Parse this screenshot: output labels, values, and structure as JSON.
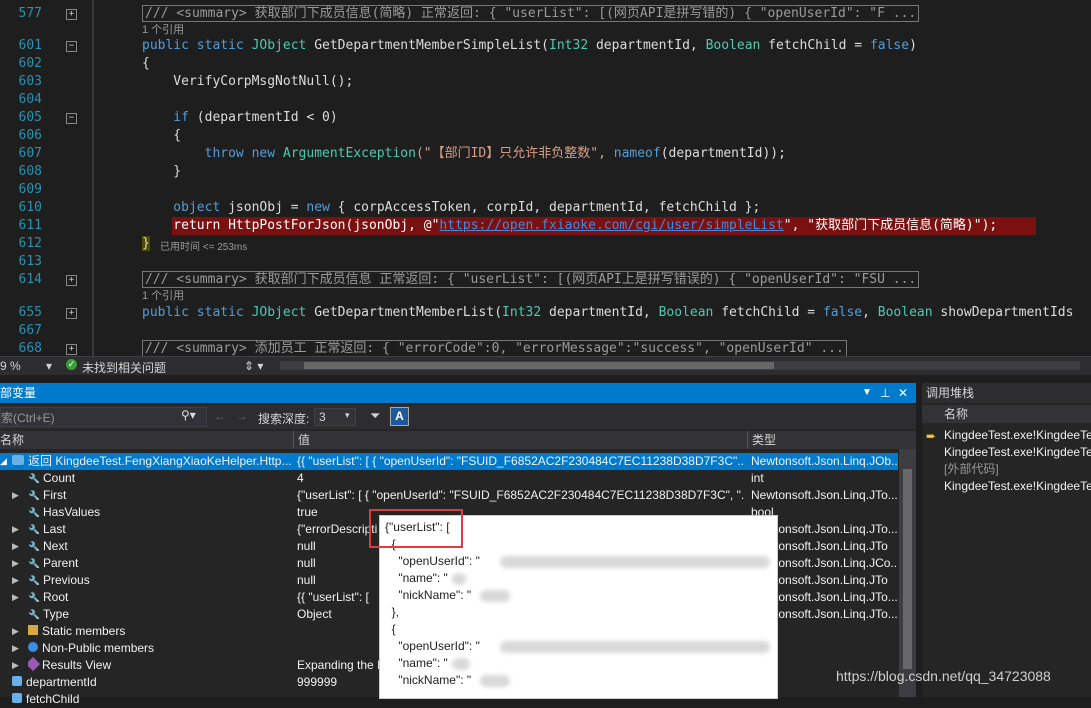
{
  "editor": {
    "line_numbers": [
      "577",
      "601",
      "602",
      "603",
      "604",
      "605",
      "606",
      "607",
      "608",
      "609",
      "610",
      "611",
      "612",
      "613",
      "614",
      "655",
      "667",
      "668"
    ],
    "line577": "/// <summary> 获取部门下成员信息(简略) 正常返回: { \"userList\": [(网页API是拼写错的) { \"openUserId\": \"F ...",
    "ref1": "1 个引用",
    "line601_a": "public static ",
    "line601_b": "JObject",
    "line601_c": " GetDepartmentMemberSimpleList(",
    "line601_d": "Int32",
    "line601_e": " departmentId, ",
    "line601_f": "Boolean",
    "line601_g": " fetchChild = ",
    "line601_h": "false",
    "line601_i": ")",
    "line602": "{",
    "line603": "    VerifyCorpMsgNotNull();",
    "line605_a": "    if",
    "line605_b": " (departmentId < 0)",
    "line606": "    {",
    "line607_a": "        throw new ",
    "line607_b": "ArgumentException",
    "line607_c": "(\"【部门ID】只允许非负整数\", ",
    "line607_d": "nameof",
    "line607_e": "(departmentId));",
    "line608": "    }",
    "line610_a": "    object",
    "line610_b": " jsonObj = ",
    "line610_c": "new",
    "line610_d": " { corpAccessToken, corpId, departmentId, fetchChild };",
    "line611_a": "    return HttpPostForJson(jsonObj, @\"",
    "line611_link": "https://open.fxiaoke.com/cgi/user/simpleList",
    "line611_c": "\", \"获取部门下成员信息(简略)\");",
    "line612": "}",
    "elapsed": "已用时间 <= 253ms",
    "line614": "/// <summary> 获取部门下成员信息 正常返回: { \"userList\": [(网页API上是拼写错误的) { \"openUserId\": \"FSU ...",
    "ref2": "1 个引用",
    "line655_a": "public static ",
    "line655_b": "JObject",
    "line655_c": " GetDepartmentMemberList(",
    "line655_d": "Int32",
    "line655_e": " departmentId, ",
    "line655_f": "Boolean",
    "line655_g": " fetchChild = ",
    "line655_h": "false",
    "line655_i": ", ",
    "line655_j": "Boolean",
    "line655_k": " showDepartmentIds",
    "line668": "/// <summary> 添加员工 正常返回: { \"errorCode\":0, \"errorMessage\":\"success\", \"openUserId\" ..."
  },
  "statusbar": {
    "zoom": "9 %",
    "issues": "未找到相关问题"
  },
  "locals": {
    "title": "部变量",
    "search_placeholder": "索(Ctrl+E)",
    "search_depth_label": "搜索深度:",
    "search_depth_value": "3",
    "columns": {
      "name": "名称",
      "value": "值",
      "type": "类型"
    },
    "rows": [
      {
        "name": "返回 KingdeeTest.FengXiangXiaoKeHelper.Http...",
        "value": "{{  \"userList\": [    {      \"openUserId\": \"FSUID_F6852AC2F230484C7EC11238D38D7F3C\"...",
        "type": "Newtonsoft.Json.Linq.JOb..."
      },
      {
        "name": "Count",
        "value": "4",
        "type": "int"
      },
      {
        "name": "First",
        "value": "{\"userList\": [  {    \"openUserId\": \"FSUID_F6852AC2F230484C7EC11238D38D7F3C\",    \"...",
        "type": "Newtonsoft.Json.Linq.JTo..."
      },
      {
        "name": "HasValues",
        "value": "true",
        "type": "bool"
      },
      {
        "name": "Last",
        "value": "{\"errorDescripti",
        "type": "Newtonsoft.Json.Linq.JTo..."
      },
      {
        "name": "Next",
        "value": "null",
        "type": "Newtonsoft.Json.Linq.JTo"
      },
      {
        "name": "Parent",
        "value": "null",
        "type": "Newtonsoft.Json.Linq.JCo..."
      },
      {
        "name": "Previous",
        "value": "null",
        "type": "Newtonsoft.Json.Linq.JTo"
      },
      {
        "name": "Root",
        "value": "{{  \"userList\": [",
        "type": "Newtonsoft.Json.Linq.JTo..."
      },
      {
        "name": "Type",
        "value": "Object",
        "type": "Newtonsoft.Json.Linq.JTo..."
      },
      {
        "name": "Static members",
        "value": "",
        "type": ""
      },
      {
        "name": "Non-Public members",
        "value": "",
        "type": ""
      },
      {
        "name": "Results View",
        "value": "Expanding the R",
        "type": ""
      },
      {
        "name": "departmentId",
        "value": "999999",
        "type": ""
      },
      {
        "name": "fetchChild",
        "value": "",
        "type": ""
      }
    ]
  },
  "callstack": {
    "title": "调用堆栈",
    "column": "名称",
    "rows": [
      "KingdeeTest.exe!KingdeeTes",
      "KingdeeTest.exe!KingdeeTes",
      "[外部代码]",
      "KingdeeTest.exe!KingdeeTes"
    ]
  },
  "tooltip": {
    "lines": [
      "{\"userList\": [",
      "  {",
      "    \"openUserId\": \"",
      "    \"name\": \"",
      "    \"nickName\": \"",
      "  },",
      "  {",
      "    \"openUserId\": \"",
      "    \"name\": \"",
      "    \"nickName\": \""
    ]
  },
  "watermark": "https://blog.csdn.net/qq_34723088"
}
